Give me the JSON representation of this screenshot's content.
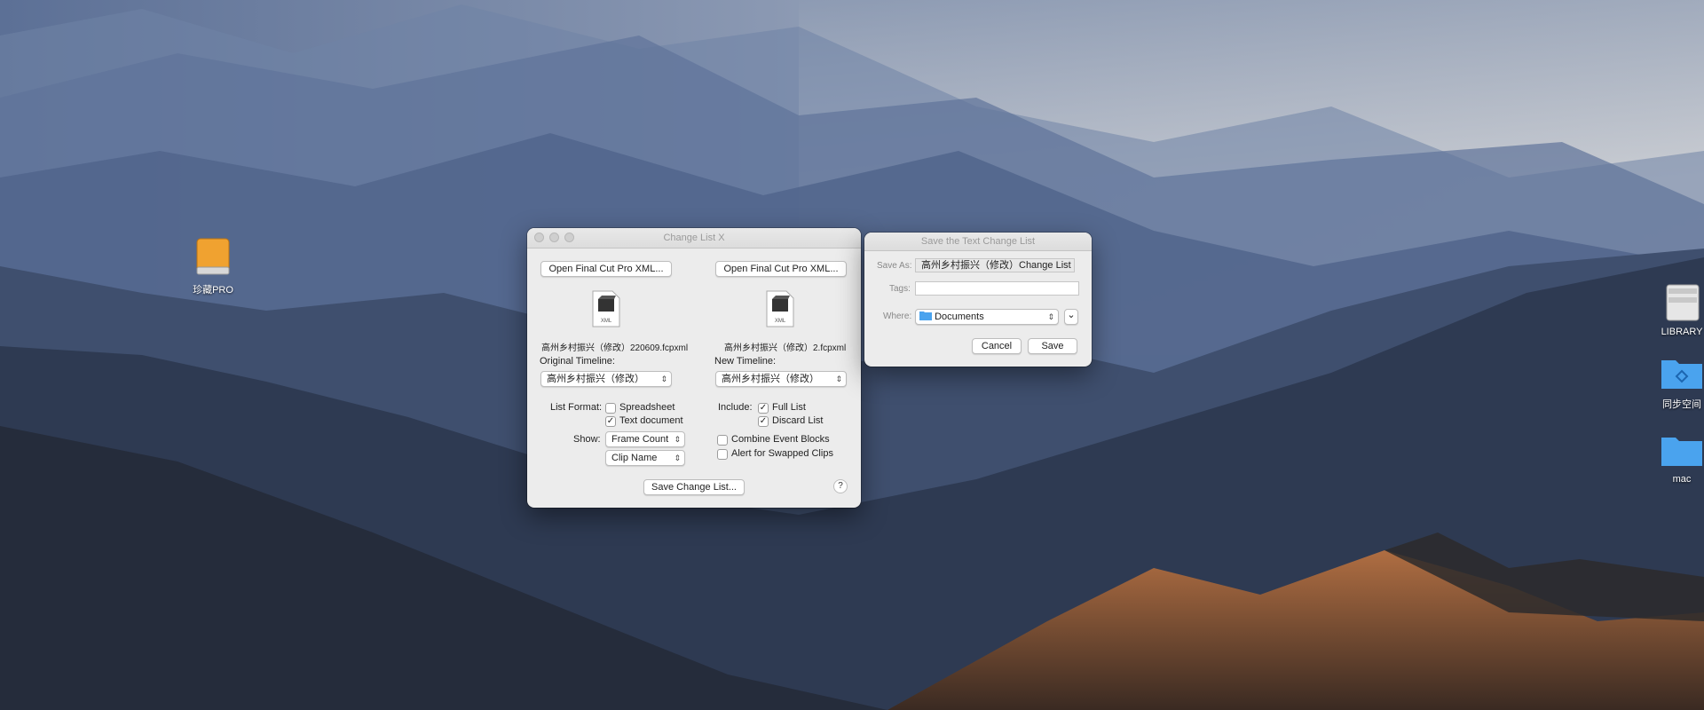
{
  "desktop": {
    "icons": [
      {
        "label": "珍藏PRO"
      },
      {
        "label": "LIBRARY"
      },
      {
        "label": "同步空间"
      },
      {
        "label": "mac"
      }
    ]
  },
  "change_list_window": {
    "title": "Change List X",
    "open_left": "Open Final Cut Pro XML...",
    "open_right": "Open Final Cut Pro XML...",
    "file_left": "高州乡村振兴（修改）220609.fcpxml",
    "file_right": "高州乡村振兴（修改）2.fcpxml",
    "xml_badge": "XML",
    "original_timeline_label": "Original Timeline:",
    "original_timeline_value": "高州乡村振兴（修改）",
    "new_timeline_label": "New Timeline:",
    "new_timeline_value": "高州乡村振兴（修改）",
    "list_format_label": "List Format:",
    "spreadsheet_label": "Spreadsheet",
    "spreadsheet_checked": false,
    "text_document_label": "Text document",
    "text_document_checked": true,
    "include_label": "Include:",
    "full_list_label": "Full List",
    "full_list_checked": true,
    "discard_list_label": "Discard List",
    "discard_list_checked": true,
    "show_label": "Show:",
    "show_value_1": "Frame Count",
    "show_value_2": "Clip Name",
    "combine_label": "Combine Event Blocks",
    "combine_checked": false,
    "alert_label": "Alert for Swapped Clips",
    "alert_checked": false,
    "save_button": "Save Change List...",
    "help": "?"
  },
  "save_dialog": {
    "title": "Save the Text Change List",
    "save_as_label": "Save As:",
    "save_as_value": "高州乡村振兴（修改）Change List",
    "tags_label": "Tags:",
    "tags_value": "",
    "where_label": "Where:",
    "where_value": "Documents",
    "expand_glyph": "⌄",
    "cancel": "Cancel",
    "save": "Save"
  },
  "colors": {
    "window_bg": "#ececec",
    "folder_blue": "#4aa3ee",
    "sky": "#c9ced6"
  }
}
